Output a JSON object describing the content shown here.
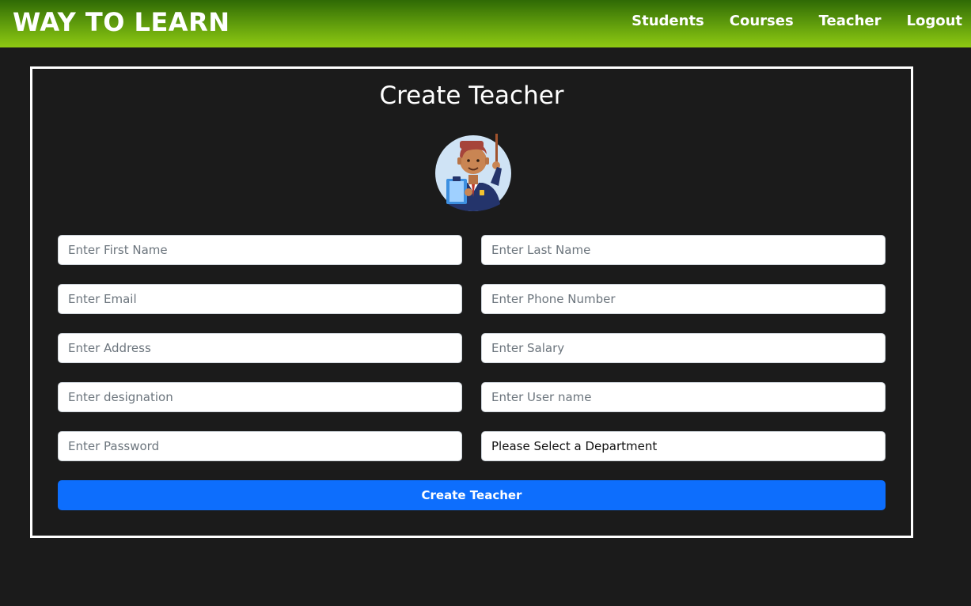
{
  "navbar": {
    "brand": "WAY TO LEARN",
    "links": [
      "Students",
      "Courses",
      "Teacher",
      "Logout"
    ]
  },
  "form": {
    "title": "Create Teacher",
    "avatar_icon": "teacher-avatar-icon",
    "fields": {
      "first_name": {
        "placeholder": "Enter First Name",
        "value": ""
      },
      "last_name": {
        "placeholder": "Enter Last Name",
        "value": ""
      },
      "email": {
        "placeholder": "Enter Email",
        "value": ""
      },
      "phone": {
        "placeholder": "Enter Phone Number",
        "value": ""
      },
      "address": {
        "placeholder": "Enter Address",
        "value": ""
      },
      "salary": {
        "placeholder": "Enter Salary",
        "value": ""
      },
      "designation": {
        "placeholder": "Enter designation",
        "value": ""
      },
      "username": {
        "placeholder": "Enter User name",
        "value": ""
      },
      "password": {
        "placeholder": "Enter Password",
        "value": ""
      },
      "department": {
        "selected": "Please Select a Department"
      }
    },
    "submit_label": "Create Teacher"
  },
  "colors": {
    "navbar_top": "#2f6a05",
    "navbar_bottom": "#8fca12",
    "background": "#1b1b1b",
    "primary_button": "#0d6efd"
  }
}
